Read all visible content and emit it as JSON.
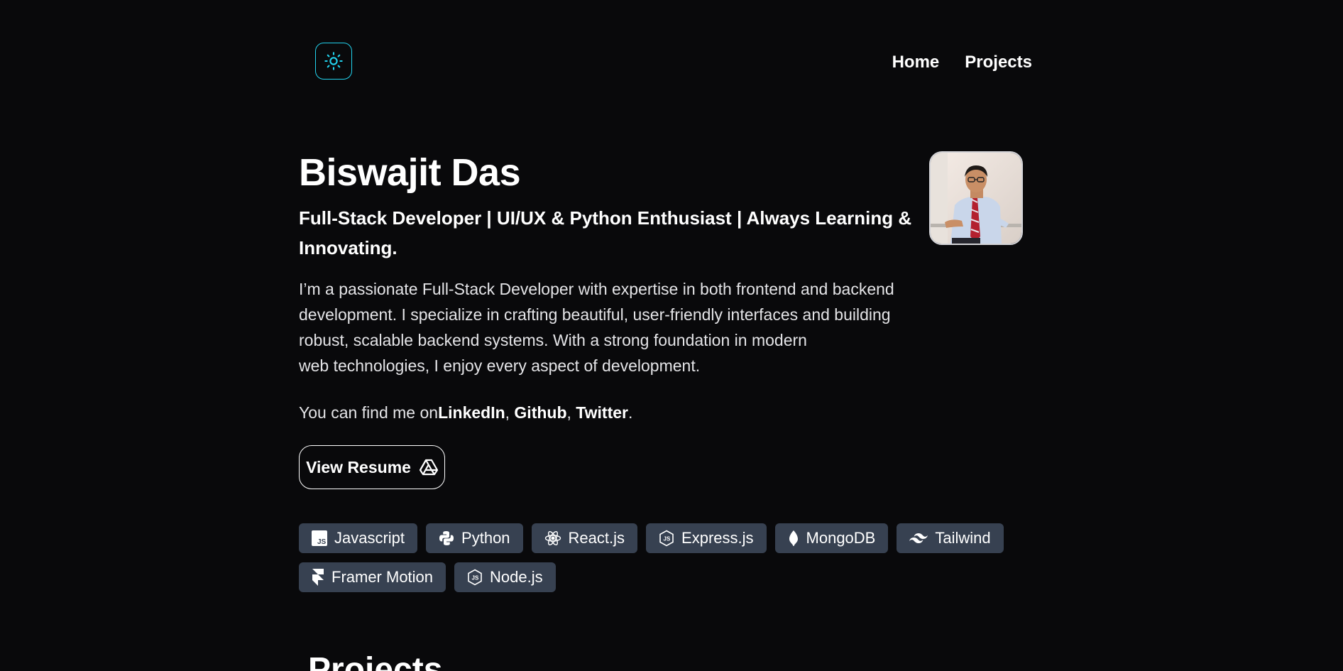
{
  "header": {
    "theme_icon": "sun-icon",
    "nav": [
      {
        "label": "Home"
      },
      {
        "label": "Projects"
      }
    ]
  },
  "hero": {
    "name": "Biswajit Das",
    "tagline": "Full-Stack Developer | UI/UX & Python Enthusiast | Always Learning & Innovating.",
    "bio_lines": [
      "I’m a passionate Full-Stack Developer with expertise in both frontend and backend",
      "development. I specialize in crafting beautiful, user-friendly interfaces and building",
      "robust, scalable backend systems. With a strong foundation in modern",
      "web technologies, I enjoy every aspect of development."
    ],
    "social": {
      "prefix": "You can find me on",
      "linkedin": "LinkedIn",
      "github": "Github",
      "twitter": "Twitter",
      "sep1": ", ",
      "sep2": ", ",
      "suffix": "."
    },
    "resume_button": "View Resume",
    "resume_icon": "google-drive-icon"
  },
  "skills": [
    {
      "label": "Javascript",
      "icon": "javascript-icon"
    },
    {
      "label": "Python",
      "icon": "python-icon"
    },
    {
      "label": "React.js",
      "icon": "react-icon"
    },
    {
      "label": "Express.js",
      "icon": "express-icon"
    },
    {
      "label": "MongoDB",
      "icon": "mongodb-icon"
    },
    {
      "label": "Tailwind",
      "icon": "tailwind-icon"
    },
    {
      "label": "Framer Motion",
      "icon": "framer-icon"
    },
    {
      "label": "Node.js",
      "icon": "nodejs-icon"
    }
  ],
  "projects": {
    "heading": "Projects"
  },
  "colors": {
    "background": "#09090b",
    "accent": "#22d3ee",
    "chip_bg": "#374151"
  }
}
